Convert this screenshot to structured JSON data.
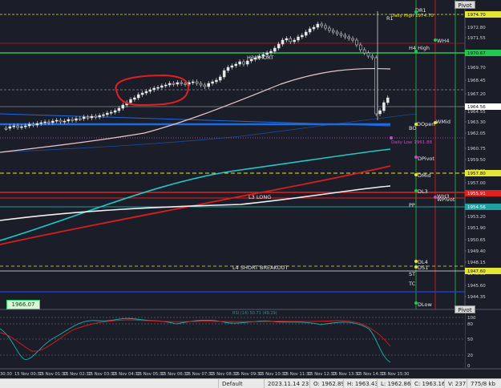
{
  "status_bar": {
    "profile": "Default",
    "datetime": "2023.11.14 23:45",
    "open": "O: 1962.89",
    "high": "H: 1963.43",
    "low": "L: 1962.86",
    "close": "C: 1963.16",
    "volume": "V: 237",
    "traffic": "775/8 kb"
  },
  "buttons": {
    "pivot_top": "Pivot",
    "pivot_bottom": "Pivot"
  },
  "price_box": "1966.07",
  "colors": {
    "background": "#1b1d29",
    "bull": "#e8e8e8",
    "bear": "#e8e8e8",
    "annotation": "#e02020",
    "fast_ma": "#e8c8c8",
    "slow_ma_red": "#d42020",
    "cyan_ma": "#20c8c8",
    "white_ma": "#f0f0f0",
    "blue_line": "#1e6be0"
  },
  "price_axis": {
    "ticks": [
      "1972.80",
      "1971.55",
      "1969.70",
      "1968.45",
      "1967.20",
      "1964.55",
      "1963.30",
      "1962.05",
      "1960.75",
      "1959.50",
      "1958.25",
      "1957.00",
      "1955.70",
      "1954.45",
      "1953.20",
      "1951.90",
      "1950.65",
      "1949.40",
      "1948.15",
      "1946.90",
      "1945.60",
      "1944.35"
    ],
    "highlights": [
      {
        "label": "1974.70",
        "color": "#e6e63a"
      },
      {
        "label": "1970.67",
        "color": "#20c850"
      },
      {
        "label": "1964.56",
        "color": "#ffffff"
      },
      {
        "label": "1957.80",
        "color": "#e6e63a"
      },
      {
        "label": "1955.91",
        "color": "#e02020"
      },
      {
        "label": "1954.56",
        "color": "#20a0a0"
      },
      {
        "label": "1947.60",
        "color": "#e6e63a"
      }
    ]
  },
  "levels": {
    "dr1": "DR1",
    "daily_high": "Daily High 1974.70",
    "r1": "R1",
    "wh4": "WH4",
    "h4_high": "H4 High",
    "h3_short": "H3 SHORT",
    "bo": "BO",
    "dopen": "DOpen",
    "wmid": "WMid",
    "daily_low": "Daily Low 1961.88",
    "dpivot": "DPivot",
    "dmid": "DMid",
    "dl3": "DL3",
    "l3_long": "L3 LONG",
    "wh3": "WH3",
    "wpivot": "WPivot",
    "pp": "PP",
    "dl4": "DL4",
    "ds1": "DS1",
    "l4_short": "L4 SHORT BREAKOUT",
    "st": "ST",
    "tc": "TC",
    "dlow": "DLow"
  },
  "oscillator": {
    "ticks": [
      "100",
      "80",
      "50",
      "20",
      "0"
    ],
    "label": "RSI (14) 50.71 (49.29)"
  },
  "time_axis": [
    "15 Nov 00:30",
    "15 Nov 01:30",
    "15 Nov 02:30",
    "15 Nov 03:30",
    "15 Nov 04:30",
    "15 Nov 05:30",
    "15 Nov 06:30",
    "15 Nov 07:30",
    "15 Nov 08:30",
    "15 Nov 09:30",
    "15 Nov 10:30",
    "15 Nov 11:30",
    "15 Nov 12:30",
    "15 Nov 13:30",
    "15 Nov 14:30",
    "15 Nov 15:30"
  ],
  "time_axis_lead": "30:30"
}
